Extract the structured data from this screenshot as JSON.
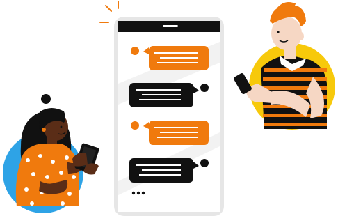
{
  "illustration": {
    "scene": "messaging-conversation",
    "phone": {
      "messages": [
        {
          "sender": "left-user",
          "bubble_color": "#f07a0d"
        },
        {
          "sender": "right-user",
          "bubble_color": "#111111"
        },
        {
          "sender": "left-user",
          "bubble_color": "#f07a0d"
        },
        {
          "sender": "right-user",
          "bubble_color": "#111111"
        }
      ],
      "typing_indicator_dots": 3
    },
    "colors": {
      "orange": "#f07a0d",
      "black": "#111111",
      "yellow": "#f7c90b",
      "blue": "#2ea3e6",
      "phone_frame": "#e6e6e6"
    },
    "icons": [
      "sparkle-icon"
    ]
  }
}
